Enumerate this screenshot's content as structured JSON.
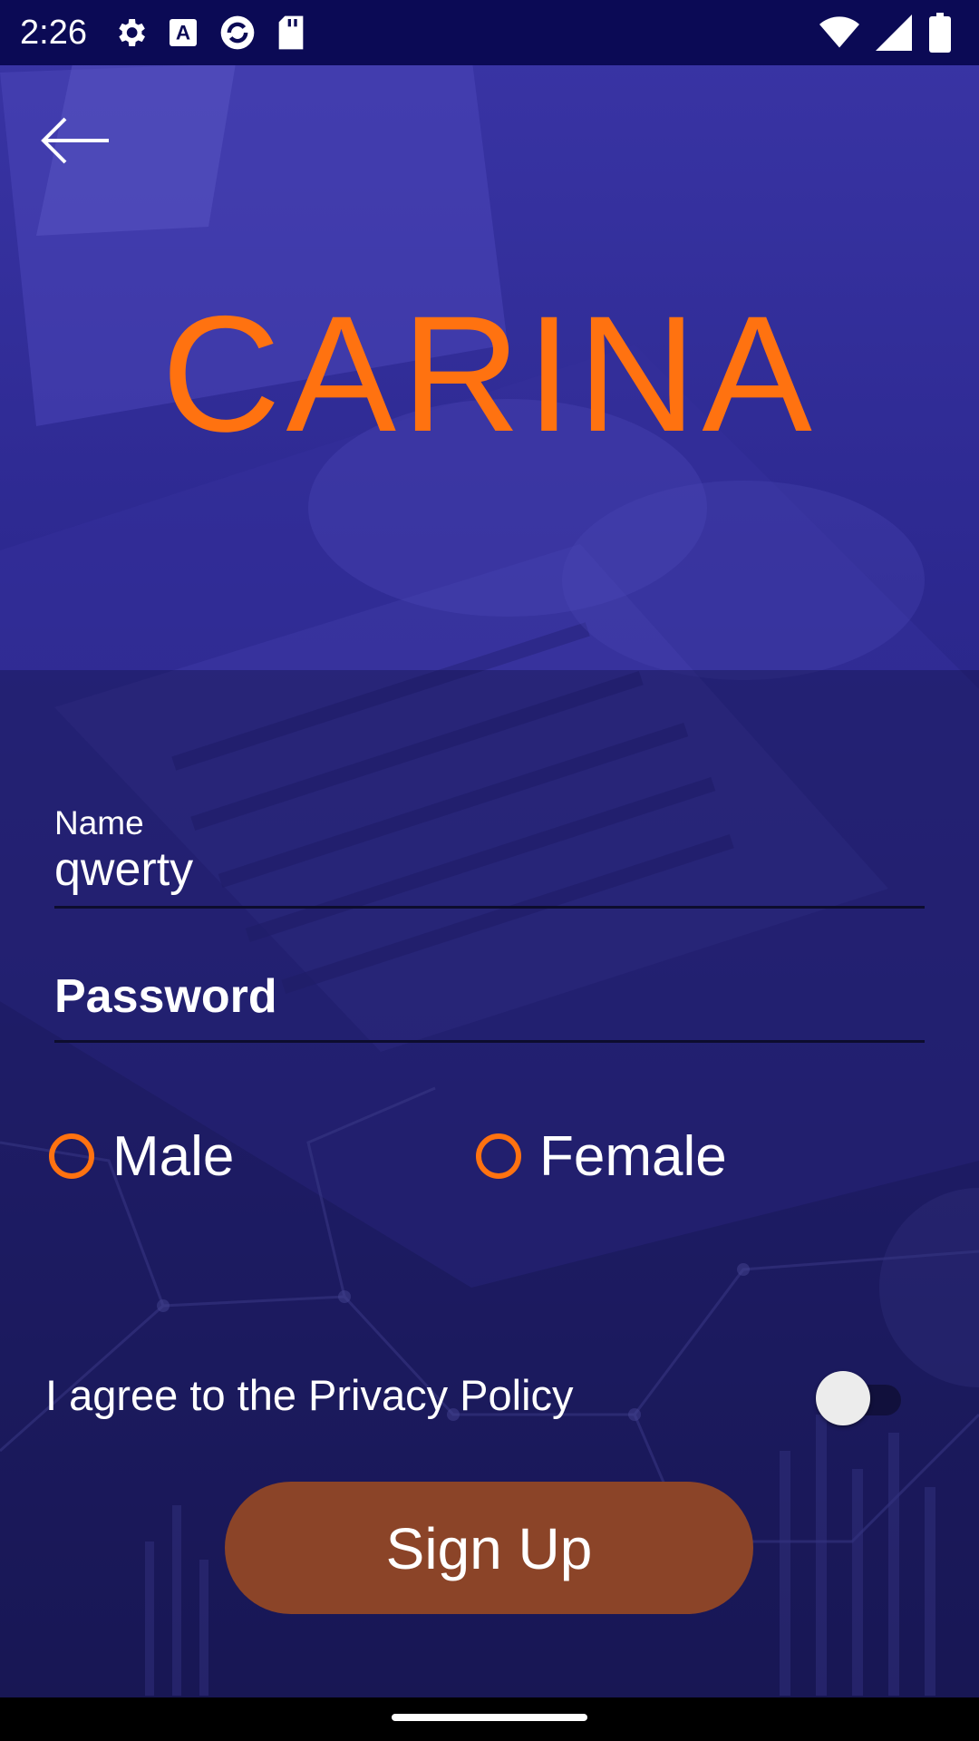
{
  "status_bar": {
    "time": "2:26",
    "left_icons": [
      "settings-icon",
      "font-a-icon",
      "sync-icon",
      "sd-card-icon"
    ],
    "right_icons": [
      "wifi-icon",
      "signal-icon",
      "battery-icon"
    ]
  },
  "header": {
    "back_icon": "arrow-left-icon",
    "logo_text": "CARINA"
  },
  "form": {
    "name": {
      "label": "Name",
      "value": "qwerty"
    },
    "password": {
      "placeholder": "Password",
      "value": ""
    },
    "gender": {
      "options": [
        {
          "label": "Male",
          "selected": false
        },
        {
          "label": "Female",
          "selected": false
        }
      ]
    },
    "privacy": {
      "label": "I agree to the Privacy Policy",
      "toggle_on": false
    },
    "submit_label": "Sign Up"
  },
  "colors": {
    "accent": "#ff7210",
    "button": "#8b4428",
    "status_bar": "#0b0a55",
    "background": "#1b1b66"
  }
}
